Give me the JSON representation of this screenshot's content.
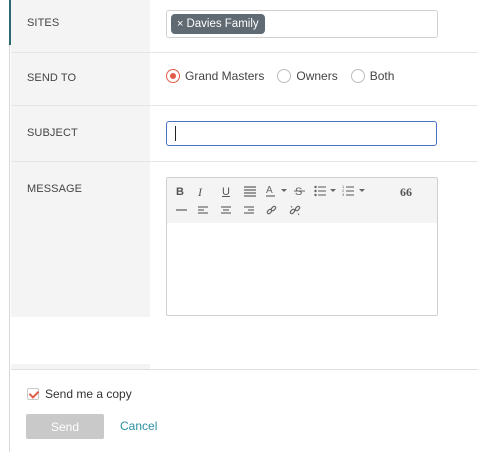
{
  "form": {
    "sites": {
      "label": "SITES",
      "chips": [
        {
          "text": "Davies Family",
          "remove_glyph": "×"
        }
      ]
    },
    "send_to": {
      "label": "SEND TO",
      "options": [
        {
          "label": "Grand Masters",
          "selected": true
        },
        {
          "label": "Owners",
          "selected": false
        },
        {
          "label": "Both",
          "selected": false
        }
      ]
    },
    "subject": {
      "label": "SUBJECT",
      "value": "",
      "placeholder": ""
    },
    "message": {
      "label": "MESSAGE",
      "toolbar": {
        "bold": "B",
        "italic": "I",
        "underline": "U",
        "blockquote": "66"
      },
      "body": ""
    }
  },
  "footer": {
    "send_copy": {
      "label": "Send me a copy",
      "checked": true
    },
    "send_label": "Send",
    "cancel_label": "Cancel"
  },
  "colors": {
    "accent_radio": "#e25c4b",
    "chip_bg": "#5f6a72",
    "focus_border": "#4a72c2",
    "link": "#2b8fa3",
    "disabled_button": "#c9c9c9"
  },
  "icons": {
    "chip_remove": "close-icon",
    "toolbar": [
      "bold-icon",
      "italic-icon",
      "underline-icon",
      "align-justify-icon",
      "text-color-icon",
      "strikethrough-icon",
      "bullet-list-icon",
      "numbered-list-icon",
      "quote-icon",
      "horizontal-rule-icon",
      "align-left-icon",
      "align-center-icon",
      "align-right-icon",
      "link-icon",
      "unlink-icon"
    ]
  }
}
